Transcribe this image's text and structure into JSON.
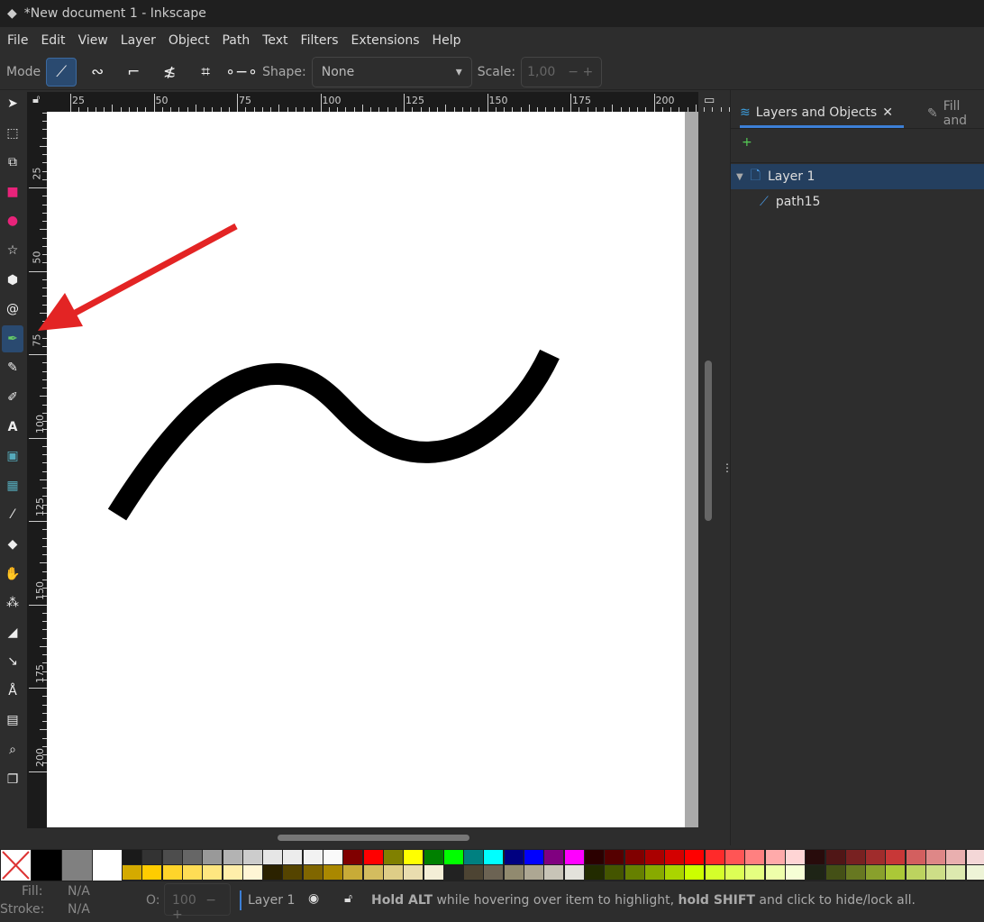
{
  "title": "*New document 1 - Inkscape",
  "menu": [
    "File",
    "Edit",
    "View",
    "Layer",
    "Object",
    "Path",
    "Text",
    "Filters",
    "Extensions",
    "Help"
  ],
  "toolbar": {
    "mode_label": "Mode",
    "shape_label": "Shape:",
    "shape_value": "None",
    "scale_label": "Scale:",
    "scale_value": "1,00"
  },
  "ruler": {
    "h": [
      "25",
      "50",
      "75",
      "100",
      "125",
      "150",
      "175",
      "200"
    ],
    "v": [
      "25",
      "50",
      "75",
      "100",
      "125",
      "150",
      "175",
      "200"
    ]
  },
  "panel": {
    "tab1": "Layers and Objects",
    "tab2": "Fill and",
    "layer": "Layer 1",
    "object": "path15"
  },
  "palette": {
    "top": [
      "#1a1a1a",
      "#333333",
      "#4d4d4d",
      "#666666",
      "#999999",
      "#b3b3b3",
      "#cccccc",
      "#e6e6e6",
      "#ececec",
      "#f2f2f2",
      "#fafafa",
      "#800000",
      "#ff0000",
      "#808000",
      "#ffff00",
      "#008000",
      "#00ff00",
      "#008080",
      "#00ffff",
      "#000080",
      "#0000ff",
      "#800080",
      "#ff00ff",
      "#2b0000",
      "#550000",
      "#800000",
      "#aa0000",
      "#d40000",
      "#ff0000",
      "#ff2a2a",
      "#ff5555",
      "#ff8080",
      "#ffaaaa",
      "#ffd5d5",
      "#280b0b",
      "#501616",
      "#782121",
      "#a02c2c",
      "#c83737",
      "#d35f5f",
      "#de8787",
      "#e9afaf",
      "#f4d7d7",
      "#241c1c",
      "#483737"
    ],
    "bottom": [
      "#d4aa00",
      "#ffcc00",
      "#ffd42a",
      "#ffdd55",
      "#ffe680",
      "#ffeeaa",
      "#fff6d5",
      "#2b2200",
      "#554400",
      "#806600",
      "#aa8800",
      "#c8ab37",
      "#d3bc5f",
      "#decd87",
      "#e9ddaf",
      "#f4eed7",
      "#222222",
      "#4d4433",
      "#6c6353",
      "#918a6f",
      "#ada793",
      "#c8c4b7",
      "#e3e2db",
      "#222b00",
      "#445500",
      "#668000",
      "#88aa00",
      "#aad400",
      "#ccff00",
      "#d4ff2a",
      "#ddff55",
      "#e5ff80",
      "#eeffaa",
      "#f6ffd5",
      "#1e2416",
      "#445016",
      "#677821",
      "#89a02c",
      "#abc837",
      "#bcd35f",
      "#cdde87",
      "#dde9af",
      "#eef4d7",
      "#1c241c",
      "#374837"
    ]
  },
  "status": {
    "fill_label": "Fill:",
    "fill_value": "N/A",
    "stroke_label": "Stroke:",
    "stroke_value": "N/A",
    "opacity_label": "O:",
    "opacity_value": "100",
    "layer": "Layer 1",
    "hint_b1": "Hold ALT",
    "hint_t1": " while hovering over item to highlight, ",
    "hint_b2": "hold SHIFT",
    "hint_t2": " and click to hide/lock all."
  },
  "colors": {
    "accent": "#3c7fd6",
    "arrow": "#e32424",
    "stroke": "#000000"
  }
}
